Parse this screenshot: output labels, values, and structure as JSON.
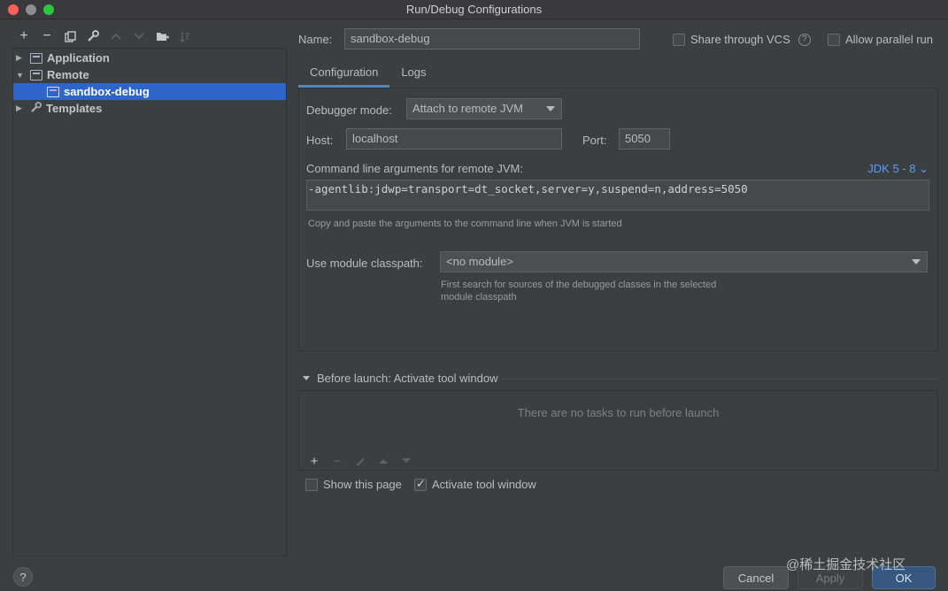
{
  "window": {
    "title": "Run/Debug Configurations"
  },
  "left_toolbar": {
    "icons": [
      "add-icon",
      "remove-icon",
      "copy-icon",
      "wrench-icon",
      "move-up-icon",
      "move-down-icon",
      "new-folder-icon",
      "sort-icon"
    ]
  },
  "tree": {
    "items": [
      {
        "label": "Application"
      },
      {
        "label": "Remote"
      },
      {
        "label": "sandbox-debug"
      },
      {
        "label": "Templates"
      }
    ]
  },
  "name_field": {
    "label": "Name:",
    "value": "sandbox-debug"
  },
  "share_vcs": {
    "label": "Share through VCS",
    "help": "?"
  },
  "allow_parallel": {
    "label": "Allow parallel run"
  },
  "tabs": [
    {
      "label": "Configuration"
    },
    {
      "label": "Logs"
    }
  ],
  "config": {
    "debugger_mode_label": "Debugger mode:",
    "debugger_mode_value": "Attach to remote JVM",
    "host_label": "Host:",
    "host_value": "localhost",
    "port_label": "Port:",
    "port_value": "5050",
    "cmd_label": "Command line arguments for remote JVM:",
    "jdk_link": "JDK 5 - 8 ⌄",
    "cmd_value": "-agentlib:jdwp=transport=dt_socket,server=y,suspend=n,address=5050",
    "cmd_hint": "Copy and paste the arguments to the command line when JVM is started",
    "module_label": "Use module classpath:",
    "module_value": "<no module>",
    "module_hint_1": "First search for sources of the debugged classes in the selected",
    "module_hint_2": "module classpath"
  },
  "before_launch": {
    "title": "Before launch: Activate tool window",
    "empty": "There are no tasks to run before launch"
  },
  "show_page": {
    "label": "Show this page",
    "checked": false
  },
  "activate_tool_window": {
    "label": "Activate tool window",
    "checked": true
  },
  "buttons": {
    "help": "?",
    "cancel": "Cancel",
    "apply": "Apply",
    "ok": "OK"
  },
  "watermark": "@稀土掘金技术社区"
}
